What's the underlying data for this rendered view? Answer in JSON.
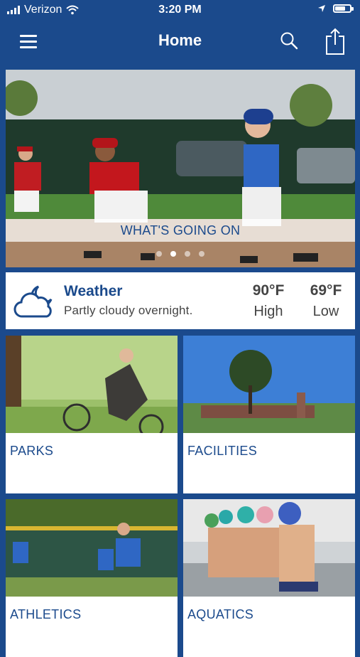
{
  "status_bar": {
    "carrier": "Verizon",
    "time": "3:20 PM"
  },
  "nav": {
    "title": "Home",
    "icons": [
      "menu-icon",
      "search-icon",
      "share-icon"
    ]
  },
  "hero": {
    "caption": "WHAT'S GOING ON",
    "pages": 4,
    "active_page": 2
  },
  "weather": {
    "title": "Weather",
    "description": "Partly cloudy overnight.",
    "high_temp": "90°F",
    "high_label": "High",
    "low_temp": "69°F",
    "low_label": "Low",
    "icon": "partly-cloudy-night-icon"
  },
  "tiles": [
    {
      "label": "PARKS"
    },
    {
      "label": "FACILITIES"
    },
    {
      "label": "ATHLETICS"
    },
    {
      "label": "AQUATICS"
    }
  ],
  "colors": {
    "brand": "#1b4a8c",
    "card": "#ffffff"
  }
}
